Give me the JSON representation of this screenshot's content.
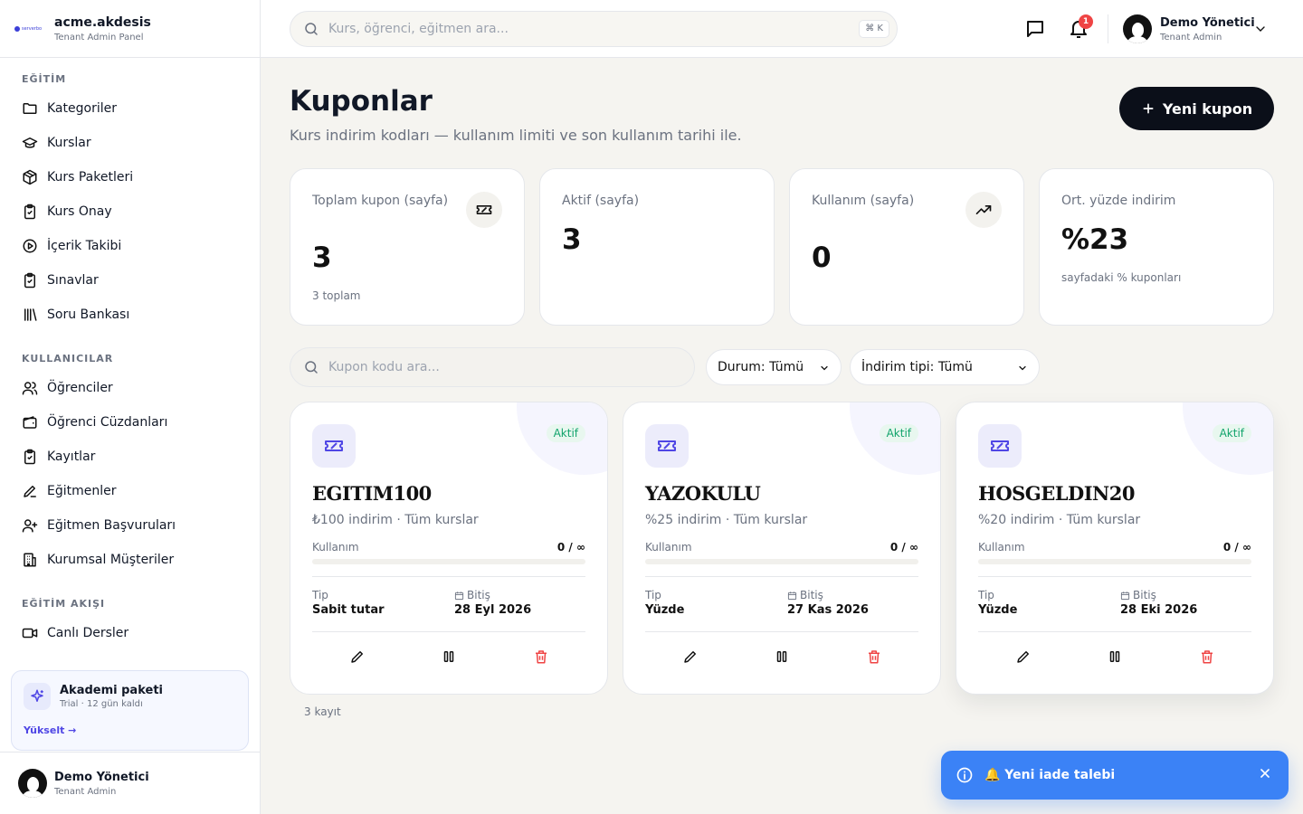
{
  "brand": {
    "logo_text": "serverbo",
    "title": "acme.akdesis",
    "subtitle": "Tenant Admin Panel"
  },
  "sidebar": {
    "sections": [
      {
        "title": "EĞİTİM",
        "items": [
          {
            "label": "Kategoriler",
            "icon": "folder-icon"
          },
          {
            "label": "Kurslar",
            "icon": "graduation-cap-icon"
          },
          {
            "label": "Kurs Paketleri",
            "icon": "package-icon"
          },
          {
            "label": "Kurs Onay",
            "icon": "clipboard-check-icon"
          },
          {
            "label": "İçerik Takibi",
            "icon": "play-circle-icon"
          },
          {
            "label": "Sınavlar",
            "icon": "clipboard-check-icon"
          },
          {
            "label": "Soru Bankası",
            "icon": "library-icon"
          }
        ]
      },
      {
        "title": "KULLANICILAR",
        "items": [
          {
            "label": "Öğrenciler",
            "icon": "users-icon"
          },
          {
            "label": "Öğrenci Cüzdanları",
            "icon": "wallet-icon"
          },
          {
            "label": "Kayıtlar",
            "icon": "clipboard-check-icon"
          },
          {
            "label": "Eğitmenler",
            "icon": "pen-icon"
          },
          {
            "label": "Eğitmen Başvuruları",
            "icon": "user-plus-icon"
          },
          {
            "label": "Kurumsal Müşteriler",
            "icon": "building-icon"
          }
        ]
      },
      {
        "title": "EĞİTİM AKIŞI",
        "items": [
          {
            "label": "Canlı Dersler",
            "icon": "video-icon"
          }
        ]
      }
    ],
    "promo": {
      "title": "Akademi paketi",
      "subtitle": "Trial · 12 gün kaldı",
      "link": "Yükselt →"
    },
    "user": {
      "name": "Demo Yönetici",
      "role": "Tenant Admin"
    }
  },
  "topbar": {
    "search_placeholder": "Kurs, öğrenci, eğitmen ara...",
    "shortcut": "⌘ K",
    "notification_count": "1",
    "user": {
      "name": "Demo Yönetici",
      "role": "Tenant Admin"
    }
  },
  "page": {
    "title": "Kuponlar",
    "subtitle": "Kurs indirim kodları — kullanım limiti ve son kullanım tarihi ile.",
    "new_button": "Yeni kupon"
  },
  "stats": [
    {
      "label": "Toplam kupon (sayfa)",
      "value": "3",
      "foot": "3 toplam",
      "icon": "ticket-icon"
    },
    {
      "label": "Aktif (sayfa)",
      "value": "3",
      "foot": "",
      "icon": ""
    },
    {
      "label": "Kullanım (sayfa)",
      "value": "0",
      "foot": "",
      "icon": "trending-up-icon"
    },
    {
      "label": "Ort. yüzde indirim",
      "value": "%23",
      "foot": "sayfadaki % kuponları",
      "icon": ""
    }
  ],
  "filters": {
    "search_placeholder": "Kupon kodu ara...",
    "status": "Durum: Tümü",
    "discount_type": "İndirim tipi: Tümü"
  },
  "coupons": [
    {
      "code": "EGITIM100",
      "status": "Aktif",
      "description": "₺100 indirim · Tüm kurslar",
      "usage_label": "Kullanım",
      "usage": "0 / ∞",
      "usage_fraction": 0,
      "type_label": "Tip",
      "type": "Sabit tutar",
      "end_label": "Bitiş",
      "end_date": "28 Eyl 2026"
    },
    {
      "code": "YAZOKULU",
      "status": "Aktif",
      "description": "%25 indirim · Tüm kurslar",
      "usage_label": "Kullanım",
      "usage": "0 / ∞",
      "usage_fraction": 0,
      "type_label": "Tip",
      "type": "Yüzde",
      "end_label": "Bitiş",
      "end_date": "27 Kas 2026"
    },
    {
      "code": "HOSGELDIN20",
      "status": "Aktif",
      "description": "%20 indirim · Tüm kurslar",
      "usage_label": "Kullanım",
      "usage": "0 / ∞",
      "usage_fraction": 0,
      "type_label": "Tip",
      "type": "Yüzde",
      "end_label": "Bitiş",
      "end_date": "28 Eki 2026"
    }
  ],
  "record_count": "3 kayıt",
  "toast": {
    "message": "🔔 Yeni iade talebi"
  },
  "colors": {
    "accent": "#4f46e5",
    "primary_button": "#0b0f19",
    "status_active_bg": "#e8f7ef",
    "status_active_text": "#10a36b",
    "danger": "#ef4444",
    "toast_bg": "#3b82f6"
  }
}
